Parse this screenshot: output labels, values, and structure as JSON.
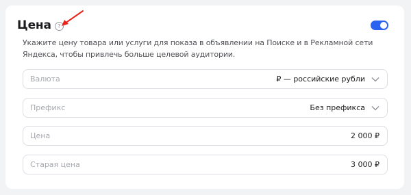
{
  "section": {
    "title": "Цена",
    "help_icon": "?",
    "toggle_on": true,
    "accent_color": "#2b63f0",
    "description": "Укажите цену товара или услуги для показа в объявлении на Поиске и в Рекламной сети Яндекса, чтобы привлечь больше целевой аудитории."
  },
  "fields": {
    "currency": {
      "label": "Валюта",
      "value": "₽ — российские рубли",
      "icon": "chevron-down-icon"
    },
    "prefix": {
      "label": "Префикс",
      "value": "Без префикса",
      "icon": "chevron-down-icon"
    },
    "price": {
      "label": "Цена",
      "value": "2 000 ₽"
    },
    "old_price": {
      "label": "Старая цена",
      "value": "3 000 ₽"
    }
  },
  "annotation": {
    "arrow_color": "#e8231b"
  }
}
